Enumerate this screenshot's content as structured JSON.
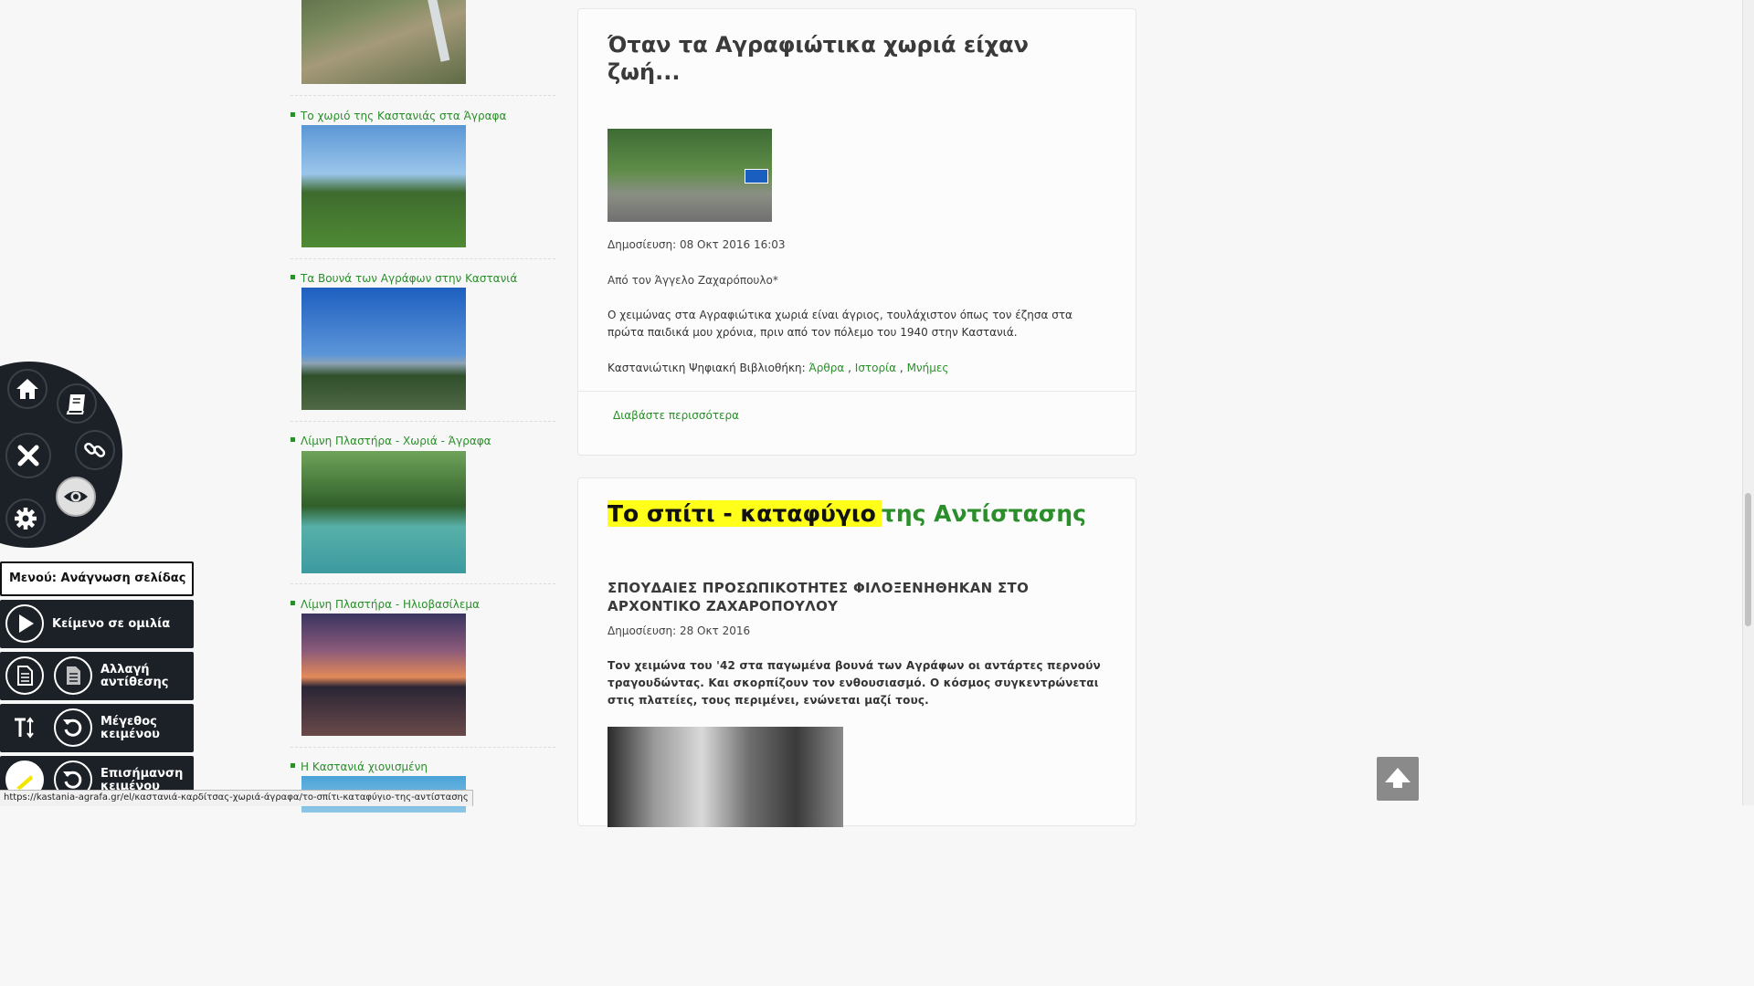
{
  "gallery": {
    "items": [
      {
        "label": "Το χωριό της Καστανιάς στα Άγραφα"
      },
      {
        "label": "Τα Βουνά των Αγράφων στην Καστανιά"
      },
      {
        "label": "Λίμνη Πλαστήρα - Χωριά - Άγραφα"
      },
      {
        "label": "Λίμνη Πλαστήρα - Ηλιοβασίλεμα"
      },
      {
        "label": "Η Καστανιά χιονισμένη"
      }
    ]
  },
  "article1": {
    "title": "Όταν τα Αγραφιώτικα χωριά είχαν ζωή...",
    "published": "Δημοσίευση: 08 Οκτ 2016 16:03",
    "author": "Από τον Άγγελο Ζαχαρόπουλο*",
    "body": "Ο χειμώνας στα Αγραφιώτικα χωριά είναι άγριος, τουλάχιστον όπως τον έζησα στα πρώτα παιδικά μου χρόνια, πριν από τον πόλεμο του 1940 στην Καστανιά.",
    "tags_label": "Καστανιώτικη Ψηφιακή Βιβλιοθήκη:",
    "tags": [
      "Άρθρα",
      "Ιστορία",
      "Μνήμες"
    ],
    "tag_sep": ",",
    "read_more": "Διαβάστε περισσότερα"
  },
  "article2": {
    "title_highlight": "Το σπίτι - καταφύγιο",
    "title_rest": "της Αντίστασης",
    "subtitle": "ΣΠΟΥΔΑΙΕΣ ΠΡΟΣΩΠΙΚΟΤΗΤΕΣ ΦΙΛΟΞΕΝΗΘΗΚΑΝ ΣΤΟ ΑΡΧΟΝΤΙΚΟ ΖΑΧΑΡΟΠΟΥΛΟΥ",
    "published": "Δημοσίευση: 28 Οκτ 2016",
    "lead": "Τον χειμώνα του '42 στα παγωμένα βουνά των Αγράφων οι αντάρτες περνούν τραγουδώντας. Και σκορπίζουν τον ενθουσιασμό. Ο κόσμος συγκεντρώνεται στις πλατείες, τους περιμένει, ενώνεται μαζί τους."
  },
  "accessibility": {
    "menu_label": "Μενού: Ανάγνωση σελίδας",
    "text_to_speech": "Κείμενο σε ομιλία",
    "contrast": "Αλλαγή αντίθεσης",
    "text_size": "Μέγεθος κειμένου",
    "highlight": "Επισήμανση κειμένου"
  },
  "status_url": "https://kastania-agrafa.gr/el/καστανιά-καρδίτσας-χωριά-άγραφα/το-σπίτι-καταφύγιο-της-αντίστασης",
  "colors": {
    "link_green": "#2a8f2a",
    "highlight_yellow": "#ffff1a",
    "toolbar_dark": "#1c2127"
  }
}
